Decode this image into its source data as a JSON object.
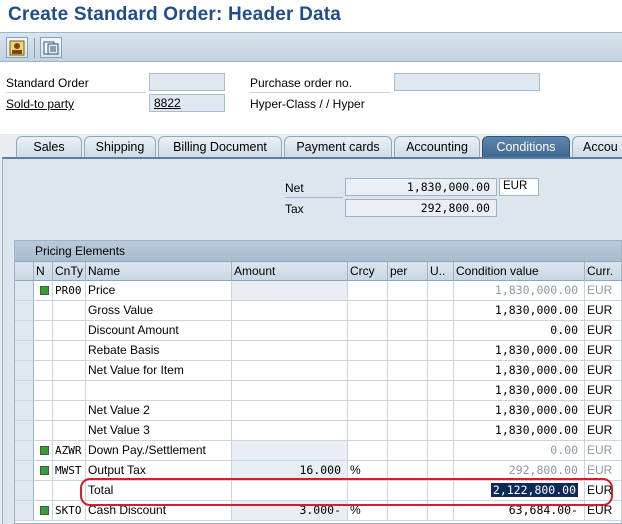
{
  "window": {
    "title": "Create Standard Order: Header Data"
  },
  "toolbar": {
    "buttons": [
      {
        "icon": "person-icon"
      },
      {
        "icon": "document-overview-icon"
      }
    ]
  },
  "header": {
    "standard_order_label": "Standard Order",
    "standard_order_value": "",
    "sold_to_label": "Sold-to party",
    "sold_to_value": "8822",
    "po_label": "Purchase order no.",
    "po_value": "",
    "customer_name": "Hyper-Class / / Hyper"
  },
  "tabs": [
    "Sales",
    "Shipping",
    "Billing Document",
    "Payment cards",
    "Accounting",
    "Conditions",
    "Accou"
  ],
  "active_tab": "Conditions",
  "summary": {
    "net_label": "Net",
    "net_value": "1,830,000.00",
    "net_currency": "EUR",
    "tax_label": "Tax",
    "tax_value": "292,800.00"
  },
  "pricing": {
    "title": "Pricing Elements",
    "columns": [
      "N",
      "CnTy",
      "Name",
      "Amount",
      "Crcy",
      "per",
      "U..",
      "Condition value",
      "Curr."
    ],
    "rows": [
      {
        "led": true,
        "cnty": "PR00",
        "name": "Price",
        "amount": "",
        "crcy": "",
        "condval": "1,830,000.00",
        "curr": "EUR",
        "grey": true
      },
      {
        "led": false,
        "cnty": "",
        "name": "Gross Value",
        "amount": "",
        "crcy": "",
        "condval": "1,830,000.00",
        "curr": "EUR",
        "grey": false
      },
      {
        "led": false,
        "cnty": "",
        "name": "Discount Amount",
        "amount": "",
        "crcy": "",
        "condval": "0.00",
        "curr": "EUR",
        "grey": false
      },
      {
        "led": false,
        "cnty": "",
        "name": "Rebate Basis",
        "amount": "",
        "crcy": "",
        "condval": "1,830,000.00",
        "curr": "EUR",
        "grey": false
      },
      {
        "led": false,
        "cnty": "",
        "name": "Net Value for Item",
        "amount": "",
        "crcy": "",
        "condval": "1,830,000.00",
        "curr": "EUR",
        "grey": false
      },
      {
        "led": false,
        "cnty": "",
        "name": "",
        "amount": "",
        "crcy": "",
        "condval": "1,830,000.00",
        "curr": "EUR",
        "grey": false
      },
      {
        "led": false,
        "cnty": "",
        "name": "Net Value 2",
        "amount": "",
        "crcy": "",
        "condval": "1,830,000.00",
        "curr": "EUR",
        "grey": false
      },
      {
        "led": false,
        "cnty": "",
        "name": "Net Value 3",
        "amount": "",
        "crcy": "",
        "condval": "1,830,000.00",
        "curr": "EUR",
        "grey": false
      },
      {
        "led": true,
        "cnty": "AZWR",
        "name": "Down Pay./Settlement",
        "amount": "",
        "crcy": "",
        "condval": "0.00",
        "curr": "EUR",
        "grey": true
      },
      {
        "led": true,
        "cnty": "MWST",
        "name": "Output Tax",
        "amount": "16.000",
        "crcy": "%",
        "condval": "292,800.00",
        "curr": "EUR",
        "grey": true
      },
      {
        "led": false,
        "cnty": "",
        "name": "Total",
        "amount": "",
        "crcy": "",
        "condval": "2,122,800.00",
        "curr": "EUR",
        "grey": false,
        "highlight": true
      },
      {
        "led": true,
        "cnty": "SKTO",
        "name": "Cash Discount",
        "amount": "3.000-",
        "crcy": "%",
        "condval": "63,684.00-",
        "curr": "EUR",
        "grey": false
      }
    ]
  },
  "colors": {
    "title": "#1f4e8c",
    "active_tab": "#3d6690",
    "highlight_oval": "#d21f2f"
  }
}
